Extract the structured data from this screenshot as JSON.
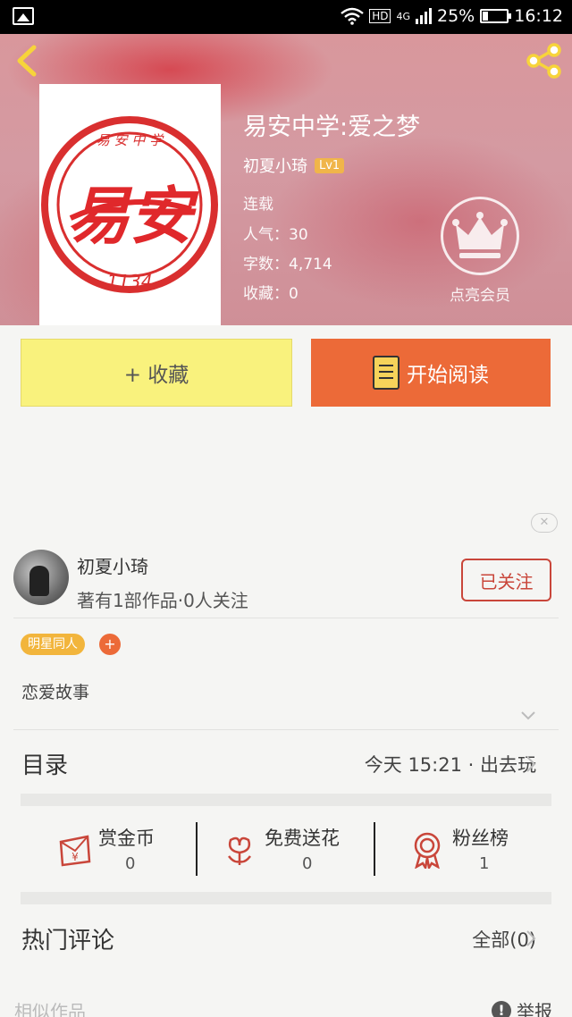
{
  "status_bar": {
    "battery": "25%",
    "time": "16:12",
    "network": "4G",
    "hd": "HD"
  },
  "book": {
    "title": "易安中学:爱之梦",
    "author": "初夏小琦",
    "level": "Lv1",
    "status": "连载",
    "popularity": "人气：30",
    "word_count": "字数：4,714",
    "collections": "收藏：0",
    "cover_text": {
      "main": "易安",
      "top": "易 安 中 学",
      "number": "1134"
    }
  },
  "vip": {
    "label": "点亮会员"
  },
  "actions": {
    "collect_label": "+ 收藏",
    "read_label": "开始阅读"
  },
  "ad": {
    "close_label": "✕"
  },
  "author_card": {
    "name": "初夏小琦",
    "stats": "著有1部作品·0人关注",
    "follow_label": "已关注"
  },
  "tags": {
    "items": [
      "明星同人"
    ],
    "add_label": "+"
  },
  "intro": "恋爱故事",
  "toc": {
    "title": "目录",
    "latest": "今天 15:21 · 出去玩"
  },
  "stats": [
    {
      "label": "赏金币",
      "value": "0",
      "icon": "red-envelope-icon"
    },
    {
      "label": "免费送花",
      "value": "0",
      "icon": "flower-icon"
    },
    {
      "label": "粉丝榜",
      "value": "1",
      "icon": "medal-icon"
    }
  ],
  "comments": {
    "title": "热门评论",
    "all_label": "全部(0)"
  },
  "footer": {
    "similar": "相似作品",
    "report": "举报"
  },
  "colors": {
    "accent_orange": "#ec6a38",
    "collect_yellow": "#f9f27d",
    "follow_red": "#c9463a",
    "tag_yellow": "#f2b53c"
  }
}
